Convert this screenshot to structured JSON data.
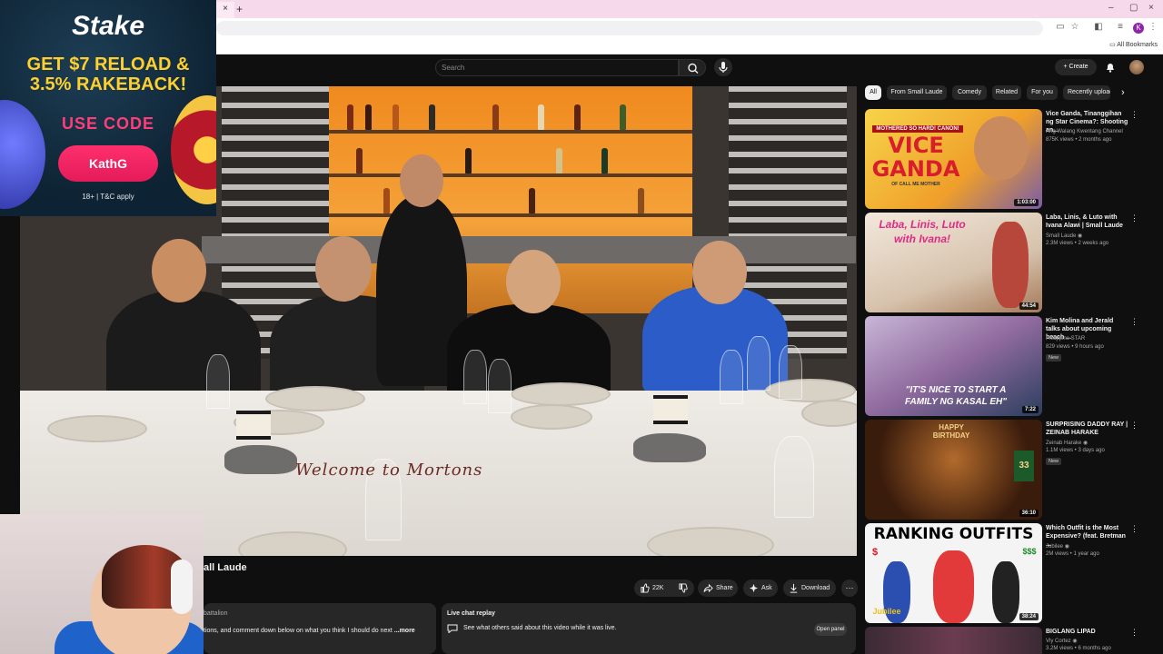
{
  "browser": {
    "tab_close": "×",
    "new_tab": "+",
    "window_controls": [
      "–",
      "▢",
      "×"
    ],
    "all_bookmarks": "All Bookmarks",
    "profile_initial": "K"
  },
  "header": {
    "search_placeholder": "Search",
    "create_label": "Create"
  },
  "ad": {
    "logo": "Stake",
    "line1": "GET $7 RELOAD &",
    "line2": "3.5% RAKEBACK!",
    "use_code": "USE CODE",
    "code": "KathG",
    "terms": "18+ | T&C apply"
  },
  "video": {
    "table_text": "Welcome to Mortons",
    "title": "all Laude",
    "channel_fragment": "battalion",
    "description": "tions, and comment down below on what you think I should do next",
    "more": "...more"
  },
  "actions": {
    "likes": "22K",
    "share": "Share",
    "ask": "Ask",
    "download": "Download"
  },
  "chat": {
    "title": "Live chat replay",
    "subtitle": "See what others said about this video while it was live.",
    "open_panel": "Open panel"
  },
  "chips": [
    "All",
    "From Small Laude",
    "Comedy",
    "Related",
    "For you",
    "Recently uploaded"
  ],
  "recommendations": [
    {
      "title": "Vice Ganda, Tinanggihan ng Star Cinema?: Shooting an...",
      "channel": "Ang Walang Kwentang Channel",
      "meta": "875K views • 2 months ago",
      "duration": "1:03:00",
      "thumb_lines": [
        "MOTHERED SO HARD! CANON!",
        "VICE",
        "GANDA",
        "OF CALL ME MOTHER"
      ],
      "verified": false,
      "badge": ""
    },
    {
      "title": "Laba, Linis, & Luto with Ivana Alawi | Small Laude",
      "channel": "Small Laude",
      "meta": "2.3M views • 2 weeks ago",
      "duration": "44:54",
      "thumb_lines": [
        "Laba, Linis, Luto",
        "with Ivana!"
      ],
      "verified": true,
      "badge": ""
    },
    {
      "title": "Kim Molina and Jerald talks about upcoming beach ...",
      "channel": "Philippine STAR",
      "meta": "829 views • 9 hours ago",
      "duration": "7:22",
      "thumb_lines": [
        "\"IT'S NICE TO START A",
        "FAMILY NG KASAL EH\""
      ],
      "verified": false,
      "badge": "New"
    },
    {
      "title": "SURPRISING DADDY RAY | ZEINAB HARAKE",
      "channel": "Zeinab Harake",
      "meta": "1.1M views • 3 days ago",
      "duration": "36:10",
      "thumb_lines": [
        "HAPPY",
        "BIRTHDAY",
        "33"
      ],
      "verified": true,
      "badge": "New"
    },
    {
      "title": "Which Outfit is the Most Expensive? (feat. Bretman ...",
      "channel": "Jubilee",
      "meta": "2M views • 1 year ago",
      "duration": "38:24",
      "thumb_lines": [
        "RANKING OUTFITS",
        "$",
        "$$$",
        "Jubilee"
      ],
      "verified": true,
      "badge": ""
    },
    {
      "title": "BIGLANG LIPAD",
      "channel": "Vly Cortez",
      "meta": "3.2M views • 6 months ago",
      "duration": "",
      "thumb_lines": [],
      "verified": true,
      "badge": ""
    }
  ]
}
